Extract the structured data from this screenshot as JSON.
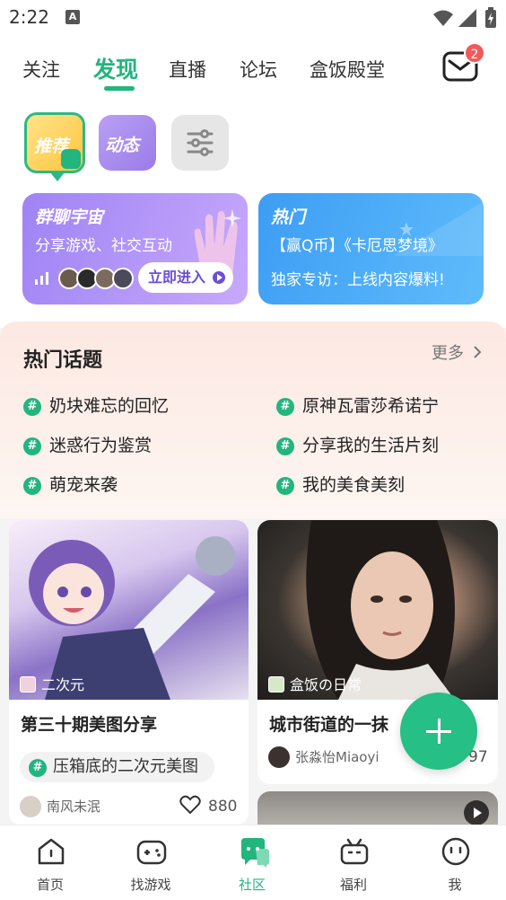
{
  "status_bar": {
    "time": "2:22",
    "notification_icon": "A"
  },
  "top_nav": {
    "tabs": [
      {
        "label": "关注"
      },
      {
        "label": "发现"
      },
      {
        "label": "直播"
      },
      {
        "label": "论坛"
      },
      {
        "label": "盒饭殿堂"
      }
    ],
    "active_tab": "发现",
    "mail_badge": "2"
  },
  "chips": {
    "recommend": "推荐",
    "dynamic": "动态"
  },
  "banner_left": {
    "title": "群聊宇宙",
    "subtitle": "分享游戏、社交互动",
    "button": "立即进入"
  },
  "banner_right": {
    "title": "热门",
    "line1": "【赢Q币】《卡厄思梦境》",
    "line2": "独家专访：上线内容爆料!"
  },
  "hot_topics": {
    "title": "热门话题",
    "more": "更多",
    "items": [
      "奶块难忘的回忆",
      "原神瓦雷莎希诺宁",
      "迷惑行为鉴赏",
      "分享我的生活片刻",
      "萌宠来袭",
      "我的美食美刻"
    ]
  },
  "feed": {
    "card_left": {
      "tag": "二次元",
      "title": "第三十期美图分享",
      "topic": "压箱底的二次元美图",
      "author": "南风未泯",
      "likes": "880"
    },
    "card_right": {
      "tag": "盒饭の日常",
      "title": "城市街道的一抹",
      "author": "张淼怡Miaoyi",
      "likes": "97"
    }
  },
  "bottom_nav": [
    {
      "label": "首页",
      "icon": "home-icon"
    },
    {
      "label": "找游戏",
      "icon": "gamepad-icon"
    },
    {
      "label": "社区",
      "icon": "chat-bubble-icon"
    },
    {
      "label": "福利",
      "icon": "gift-icon"
    },
    {
      "label": "我",
      "icon": "smile-face-icon"
    }
  ],
  "colors": {
    "accent": "#22b57e",
    "badge": "#f15a5a",
    "banner_purple": "#9f83f4",
    "banner_blue": "#3d9df4"
  }
}
